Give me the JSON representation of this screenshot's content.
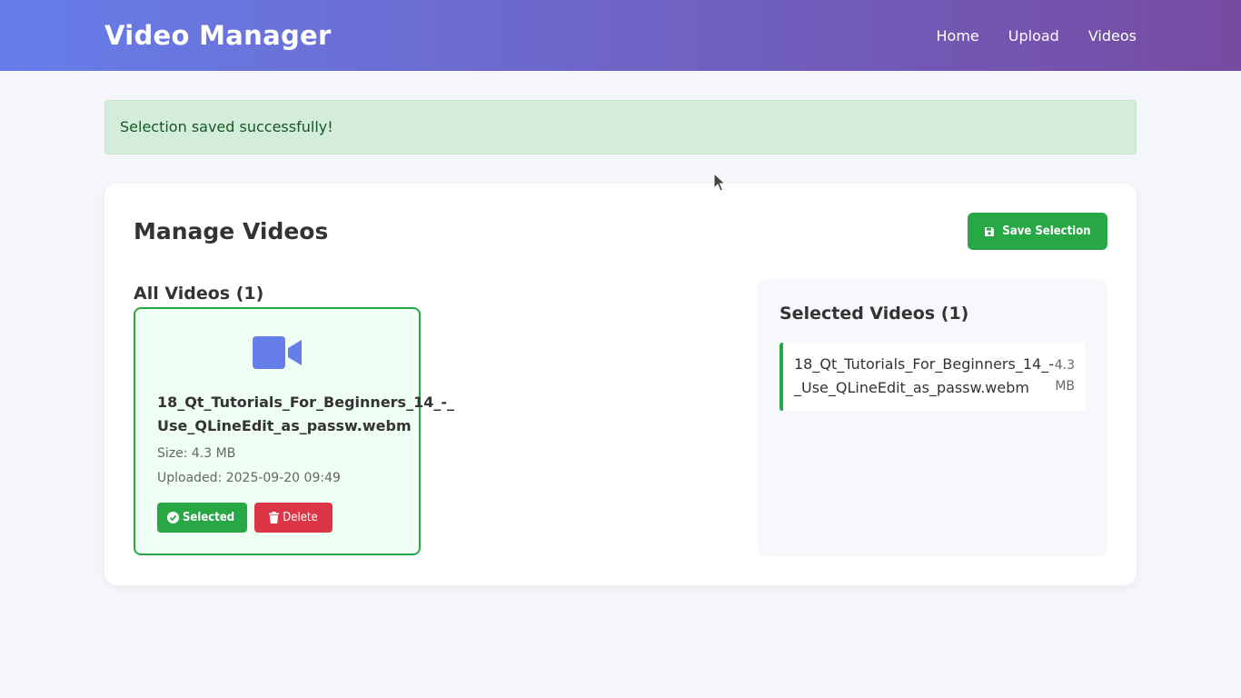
{
  "header": {
    "title": "Video Manager",
    "nav": [
      "Home",
      "Upload",
      "Videos"
    ]
  },
  "alert": {
    "message": "Selection saved successfully!"
  },
  "main": {
    "title": "Manage Videos",
    "save_button": "Save Selection",
    "all_videos_title": "All Videos (1)",
    "videos": [
      {
        "name": "18_Qt_Tutorials_For_Beginners_14_-_Use_QLineEdit_as_passw.webm",
        "size": "Size: 4.3 MB",
        "uploaded": "Uploaded: 2025-09-20 09:49",
        "selected_label": "Selected",
        "delete_label": "Delete"
      }
    ],
    "selected_title": "Selected Videos (1)",
    "selected": [
      {
        "name": "18_Qt_Tutorials_For_Beginners_14_-_Use_QLineEdit_as_passw.webm",
        "size": "4.3 MB"
      }
    ]
  },
  "colors": {
    "header_gradient_start": "#667eea",
    "header_gradient_end": "#764ba2",
    "success": "#28a745",
    "danger": "#dc3545",
    "icon": "#667eea"
  },
  "icons": {
    "save": "floppy-disk-icon",
    "video": "video-camera-icon",
    "check": "check-circle-icon",
    "trash": "trash-icon"
  }
}
